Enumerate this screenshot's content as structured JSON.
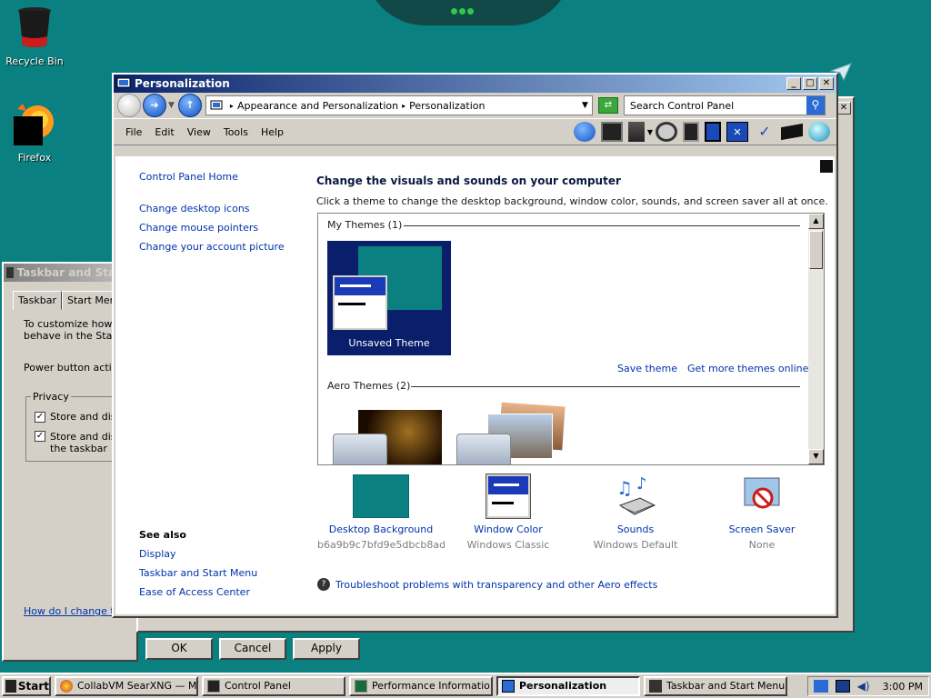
{
  "desktop": {
    "icons": [
      {
        "label": "Recycle Bin"
      },
      {
        "label": "Firefox"
      }
    ]
  },
  "taskbar_dialog": {
    "title": "Taskbar and Start Menu Properties",
    "tabs": [
      "Taskbar",
      "Start Menu"
    ],
    "description_line1": "To customize how lin",
    "description_line2": "behave in the Start",
    "power_button_label": "Power button action",
    "privacy_label": "Privacy",
    "checkbox1": "Store and disp",
    "checkbox2_line1": "Store and disp",
    "checkbox2_line2": "the taskbar",
    "help_link": "How do I change the",
    "ok": "OK",
    "cancel": "Cancel",
    "apply": "Apply"
  },
  "window": {
    "title": "Personalization",
    "breadcrumb": [
      "Appearance and Personalization",
      "Personalization"
    ],
    "search_placeholder": "Search Control Panel",
    "menu": [
      "File",
      "Edit",
      "View",
      "Tools",
      "Help"
    ]
  },
  "sidebar": {
    "home": "Control Panel Home",
    "links": [
      "Change desktop icons",
      "Change mouse pointers",
      "Change your account picture"
    ],
    "see_also_title": "See also",
    "see_also": [
      "Display",
      "Taskbar and Start Menu",
      "Ease of Access Center"
    ]
  },
  "main": {
    "heading": "Change the visuals and sounds on your computer",
    "subheading": "Click a theme to change the desktop background, window color, sounds, and screen saver all at once.",
    "my_themes": "My Themes (1)",
    "unsaved_theme": "Unsaved Theme",
    "save_theme": "Save theme",
    "get_more": "Get more themes online",
    "aero_themes": "Aero Themes (2)",
    "items": [
      {
        "label": "Desktop Background",
        "sub": "b6a9b9c7bfd9e5dbcb8ad..."
      },
      {
        "label": "Window Color",
        "sub": "Windows Classic"
      },
      {
        "label": "Sounds",
        "sub": "Windows Default"
      },
      {
        "label": "Screen Saver",
        "sub": "None"
      }
    ],
    "troubleshoot": "Troubleshoot problems with transparency and other Aero effects"
  },
  "taskbar": {
    "start": "Start",
    "tasks": [
      "CollabVM SearXNG — Mo...",
      "Control Panel",
      "Performance Informatio...",
      "Personalization",
      "Taskbar and Start Menu ..."
    ],
    "time": "3:00 PM"
  },
  "colors": {
    "desktop": "#0a8080",
    "titlebar_active": "#0a246a",
    "link": "#0033aa",
    "theme_bg": "#0a1f6b"
  }
}
